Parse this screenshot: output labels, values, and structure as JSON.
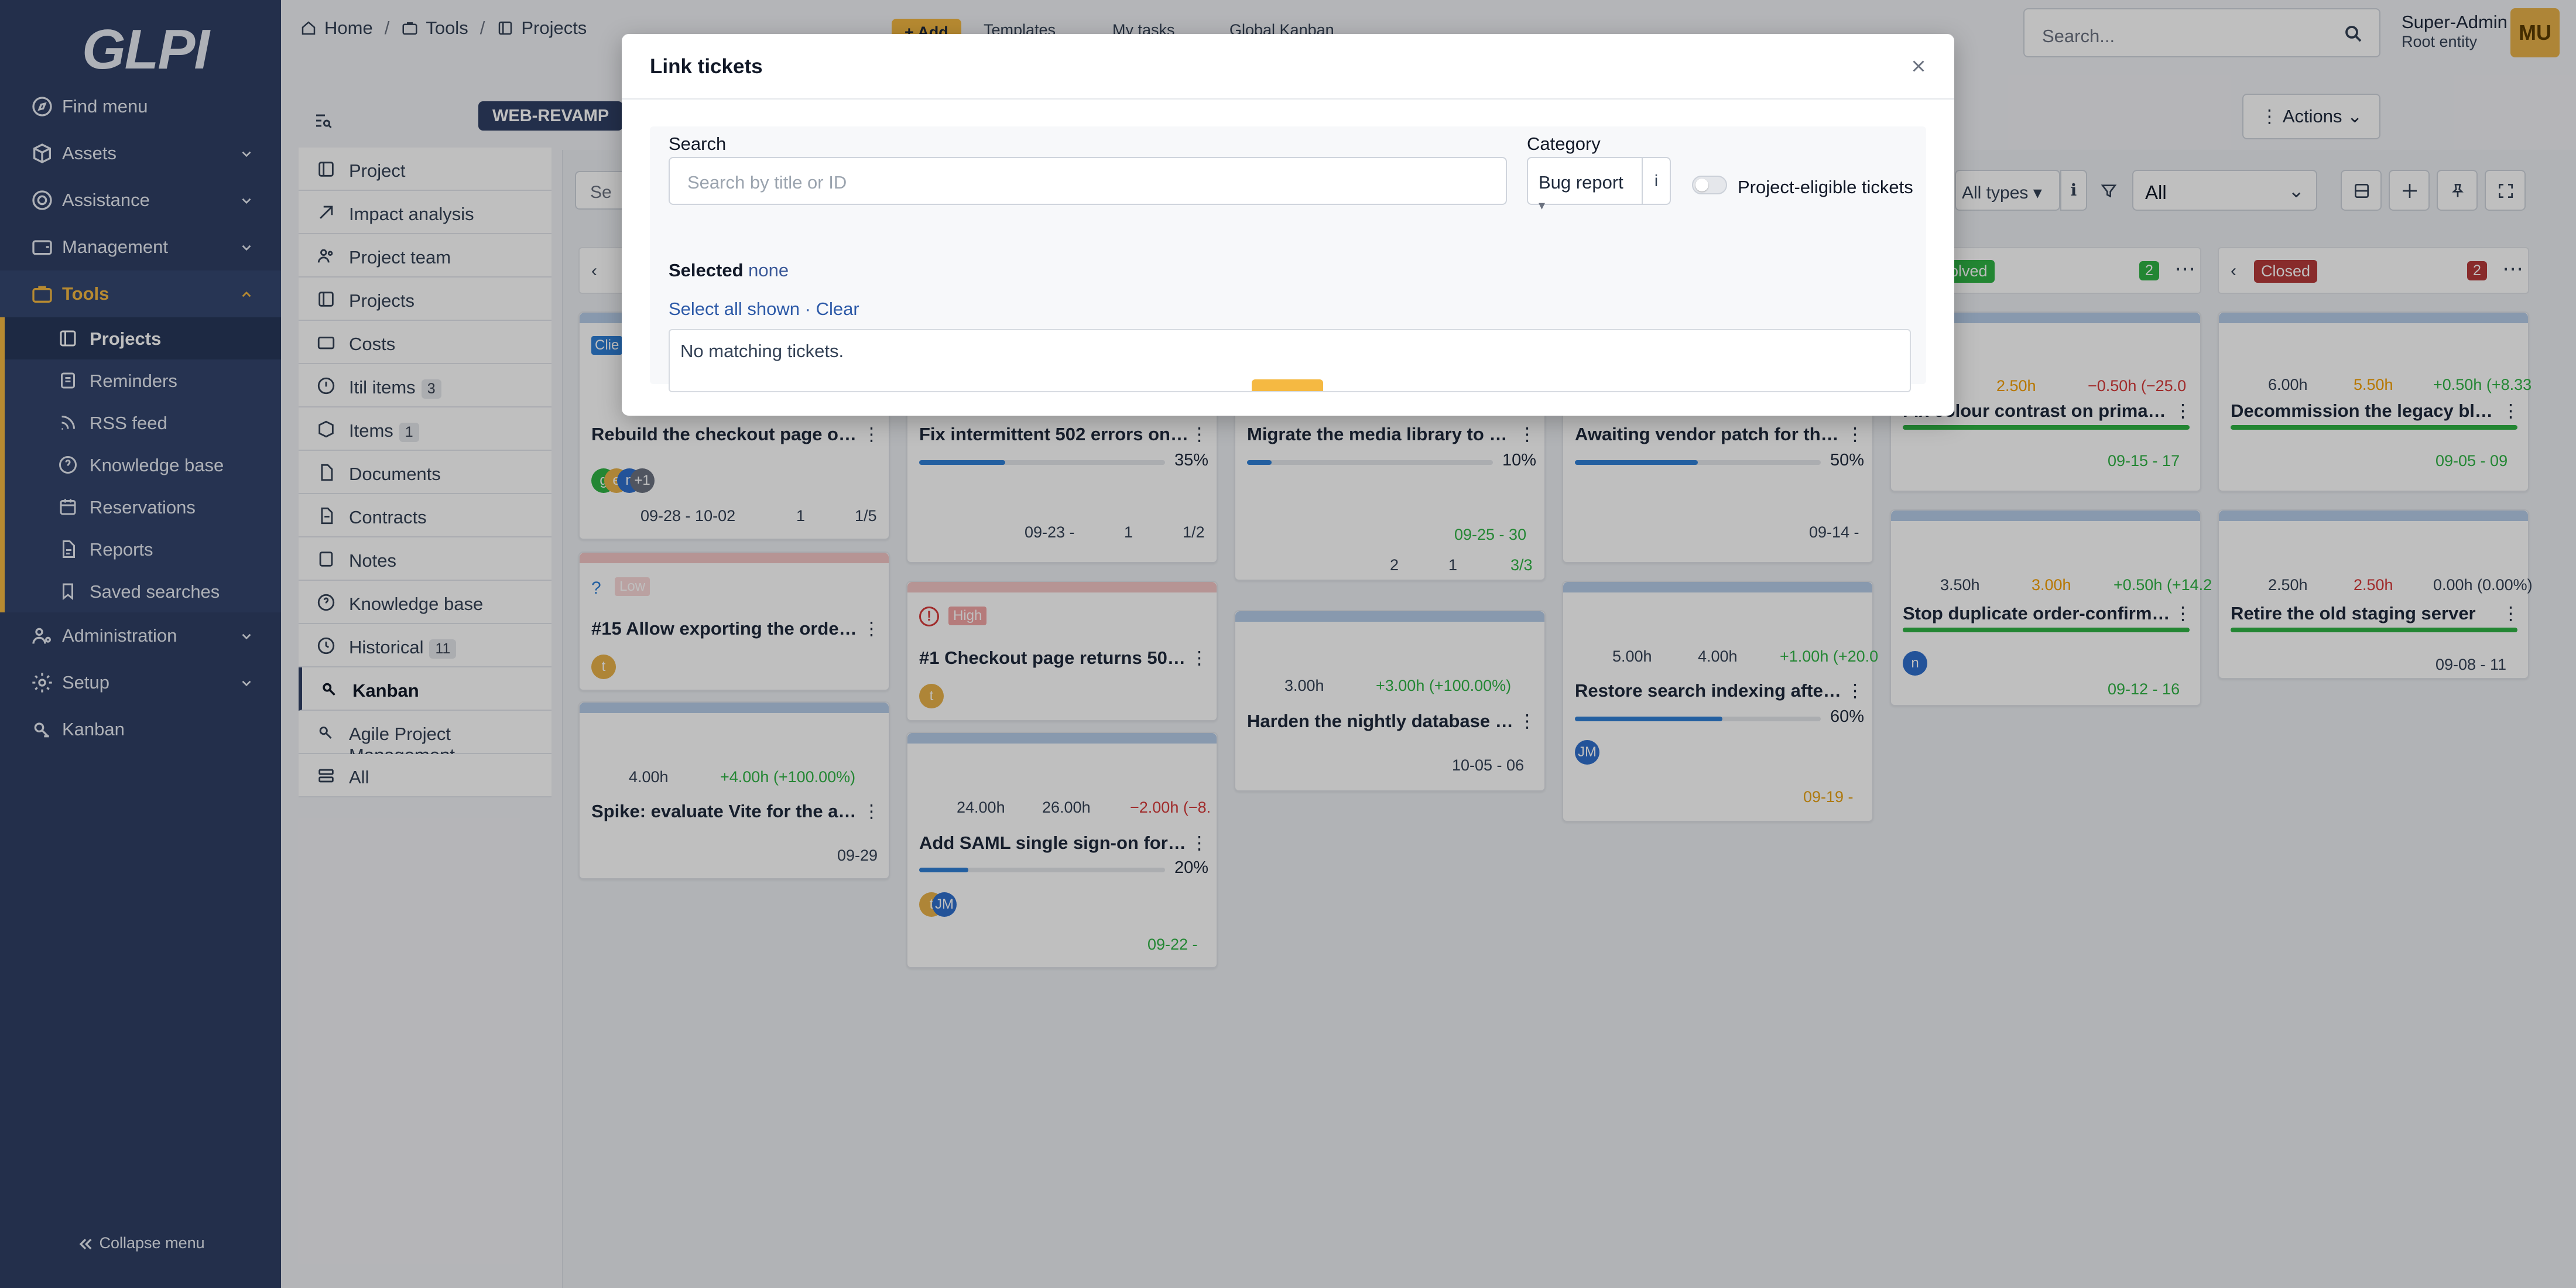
{
  "sidebar": {
    "logo": "GLPI",
    "menu": [
      {
        "label": "Find menu"
      },
      {
        "label": "Assets"
      },
      {
        "label": "Assistance"
      },
      {
        "label": "Management"
      },
      {
        "label": "Tools"
      }
    ],
    "tools_sub": [
      "Projects",
      "Reminders",
      "RSS feed",
      "Knowledge base",
      "Reservations",
      "Reports",
      "Saved searches"
    ],
    "menu2": [
      "Administration",
      "Setup",
      "Kanban"
    ],
    "collapse": "Collapse menu"
  },
  "topbar": {
    "crumbs": [
      "Home",
      "Tools",
      "Projects"
    ],
    "add": "Add",
    "templates": "Templates",
    "my_tasks": "My tasks",
    "global_kanban": "Global Kanban",
    "search_placeholder": "Search...",
    "user_name": "Super-Admin",
    "user_entity": "Root entity",
    "avatar": "MU"
  },
  "project": {
    "pill": "WEB-REVAMP",
    "actions": "Actions",
    "tabs": [
      {
        "label": "Project"
      },
      {
        "label": "Impact analysis"
      },
      {
        "label": "Project team"
      },
      {
        "label": "Projects"
      },
      {
        "label": "Costs"
      },
      {
        "label": "Itil items",
        "count": "3"
      },
      {
        "label": "Items",
        "count": "1"
      },
      {
        "label": "Documents"
      },
      {
        "label": "Contracts"
      },
      {
        "label": "Notes"
      },
      {
        "label": "Knowledge base"
      },
      {
        "label": "Historical",
        "count": "11"
      },
      {
        "label": "Kanban"
      },
      {
        "label": "Agile Project Management"
      },
      {
        "label": "All"
      }
    ]
  },
  "filters": {
    "types": "All types",
    "filter_value": "All"
  },
  "columns": [
    {
      "name": "Solved",
      "count": "2"
    },
    {
      "name": "Closed",
      "count": "2"
    }
  ],
  "cards": {
    "c1": {
      "badge": "Clie",
      "title": "Rebuild the checkout page on th...",
      "dates": "09-28 - 10-02",
      "att": "1",
      "sub": "1/5",
      "avs": [
        "g",
        "e",
        "n",
        "+1"
      ]
    },
    "c2": {
      "prio": "Low",
      "title": "#15 Allow exporting the order hi...",
      "av": "t"
    },
    "c3": {
      "time": "4.00h",
      "delta": "+4.00h (+100.00%)",
      "title": "Spike: evaluate Vite for the asset...",
      "date": "09-29"
    },
    "c4": {
      "title": "Fix intermittent 502 errors on th...",
      "pct": "35%",
      "date": "09-23 -",
      "comments": "1",
      "sub": "1/2"
    },
    "c5": {
      "prio": "High",
      "title": "#1 Checkout page returns 502 d...",
      "av": "t"
    },
    "c6": {
      "time": "24.00h",
      "real": "26.00h",
      "delta": "−2.00h (−8.",
      "title": "Add SAML single sign-on for staf...",
      "pct": "20%",
      "date": "09-22 -",
      "avs": [
        "t",
        "JM"
      ]
    },
    "c7": {
      "title": "Migrate the media library to obj...",
      "pct": "10%",
      "date": "09-25 - 30",
      "comments": "2",
      "att": "1",
      "sub": "3/3"
    },
    "c8": {
      "time": "3.00h",
      "delta": "+3.00h (+100.00%)",
      "title": "Harden the nightly database bac...",
      "date": "10-05 - 06"
    },
    "c9": {
      "title": "Awaiting vendor patch for the p...",
      "pct": "50%",
      "date": "09-14 -"
    },
    "c10": {
      "time": "5.00h",
      "real": "4.00h",
      "delta": "+1.00h (+20.0",
      "title": "Restore search indexing after th...",
      "pct": "60%",
      "date": "09-19 -",
      "av": "JM"
    },
    "c11": {
      "real": "2.50h",
      "delta": "−0.50h (−25.0",
      "title": "Fix colour contrast on primary b...",
      "date": "09-15 - 17",
      "time": "00h"
    },
    "c12": {
      "time": "3.50h",
      "real": "3.00h",
      "delta": "+0.50h (+14.2",
      "title": "Stop duplicate order-confirmati...",
      "date": "09-12 - 16",
      "av": "n"
    },
    "c13": {
      "time": "6.00h",
      "real": "5.50h",
      "delta": "+0.50h (+8.33",
      "title": "Decommission the legacy blog a...",
      "date": "09-05 - 09"
    },
    "c14": {
      "time": "2.50h",
      "real": "2.50h",
      "delta": "0.00h (0.00%)",
      "title": "Retire the old staging server",
      "date": "09-08 - 11"
    }
  },
  "modal": {
    "title": "Link tickets",
    "search_label": "Search",
    "search_placeholder": "Search by title or ID",
    "category_label": "Category",
    "category_value": "Bug report",
    "info": "i",
    "toggle_label": "Project-eligible tickets",
    "selected_label": "Selected",
    "selected_value": "none",
    "select_all": "Select all shown",
    "dot": "·",
    "clear": "Clear",
    "no_results": "No matching tickets."
  }
}
